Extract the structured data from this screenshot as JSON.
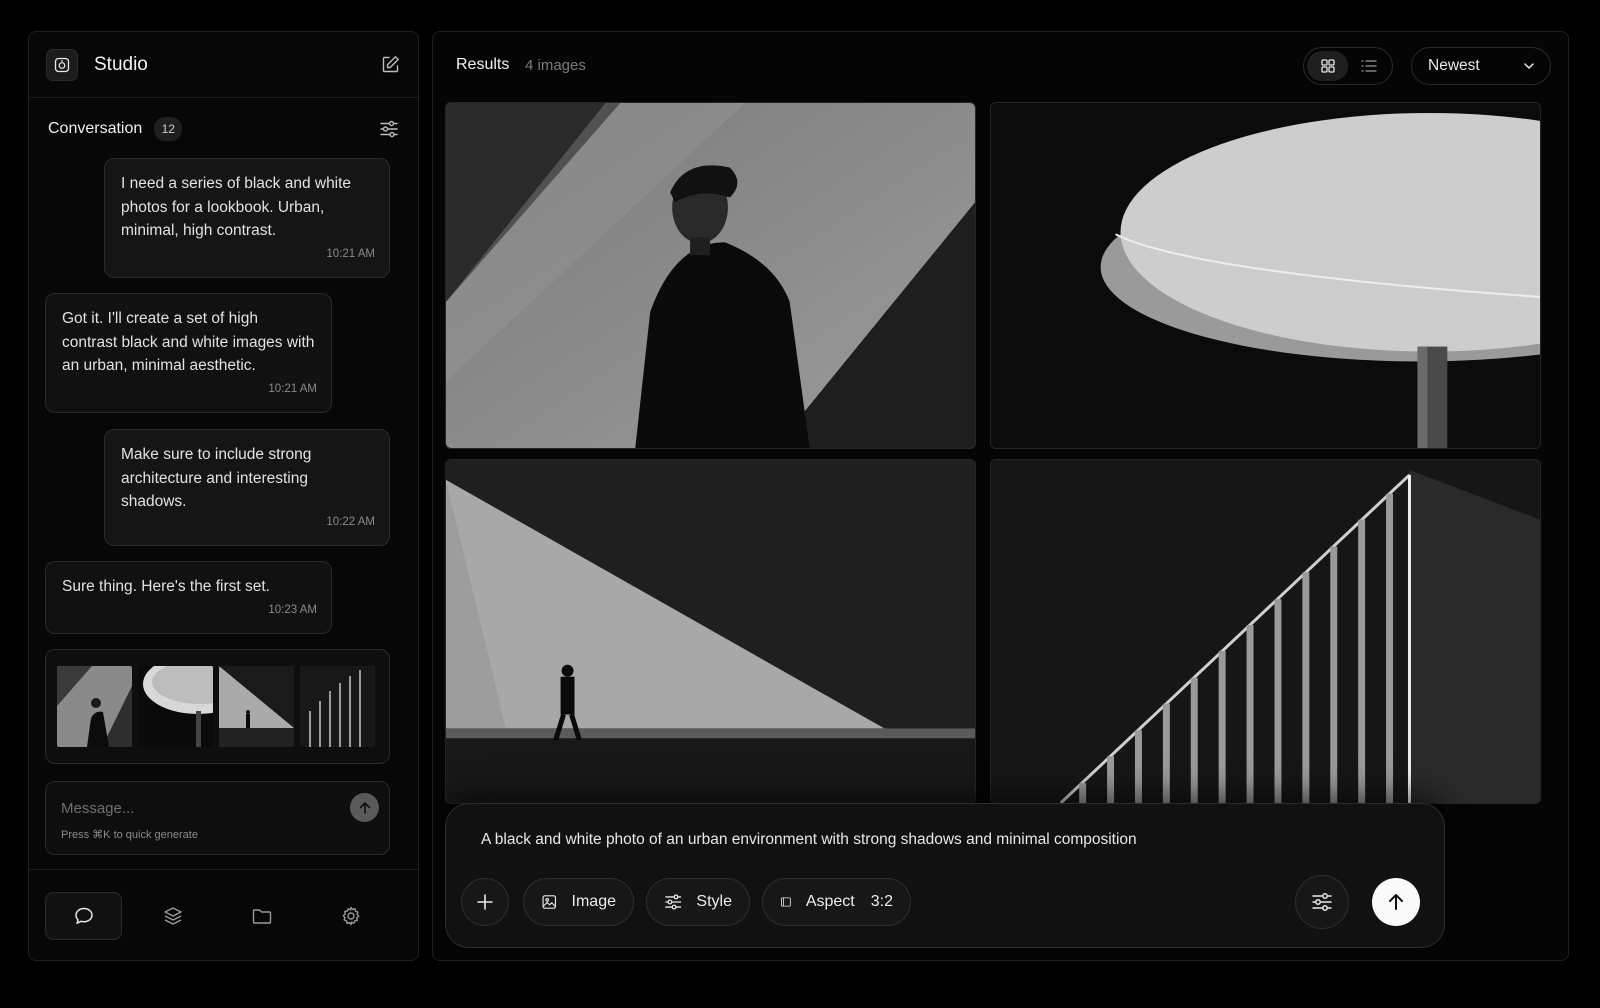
{
  "app": {
    "title": "Studio"
  },
  "icons": {
    "logo": "camera-logo-icon",
    "new_chat": "edit-icon",
    "filters": "sliders-icon",
    "send": "arrow-up-icon",
    "nav": [
      "chat-icon",
      "layers-icon",
      "folder-icon",
      "settings-icon"
    ]
  },
  "conversation": {
    "title": "Conversation",
    "count": "12",
    "messages": [
      {
        "role": "user",
        "text": "I need a series of black and white photos for a lookbook. Urban, minimal, high contrast.",
        "time": "10:21 AM"
      },
      {
        "role": "assistant",
        "text": "Got it. I'll create a set of high contrast black and white images with an urban, minimal aesthetic.",
        "time": "10:21 AM"
      },
      {
        "role": "user",
        "text": "Make sure to include strong architecture and interesting shadows.",
        "time": "10:22 AM"
      },
      {
        "role": "assistant",
        "text": "Sure thing. Here's the first set.",
        "time": "10:23 AM"
      }
    ]
  },
  "composer": {
    "placeholder": "Message...",
    "hint": "Press ⌘K to quick generate"
  },
  "results": {
    "title": "Results",
    "count": "4 images",
    "sort": "Newest",
    "view": "grid"
  },
  "prompt": {
    "text": "A black and white photo of an urban environment with strong shadows and minimal composition",
    "image_label": "Image",
    "style_label": "Style",
    "aspect_label": "Aspect",
    "aspect_value": "3:2"
  },
  "colors": {
    "background": "#000000",
    "panel": "#070707",
    "border": "#1f1f1f",
    "accent": "#fafafa"
  }
}
